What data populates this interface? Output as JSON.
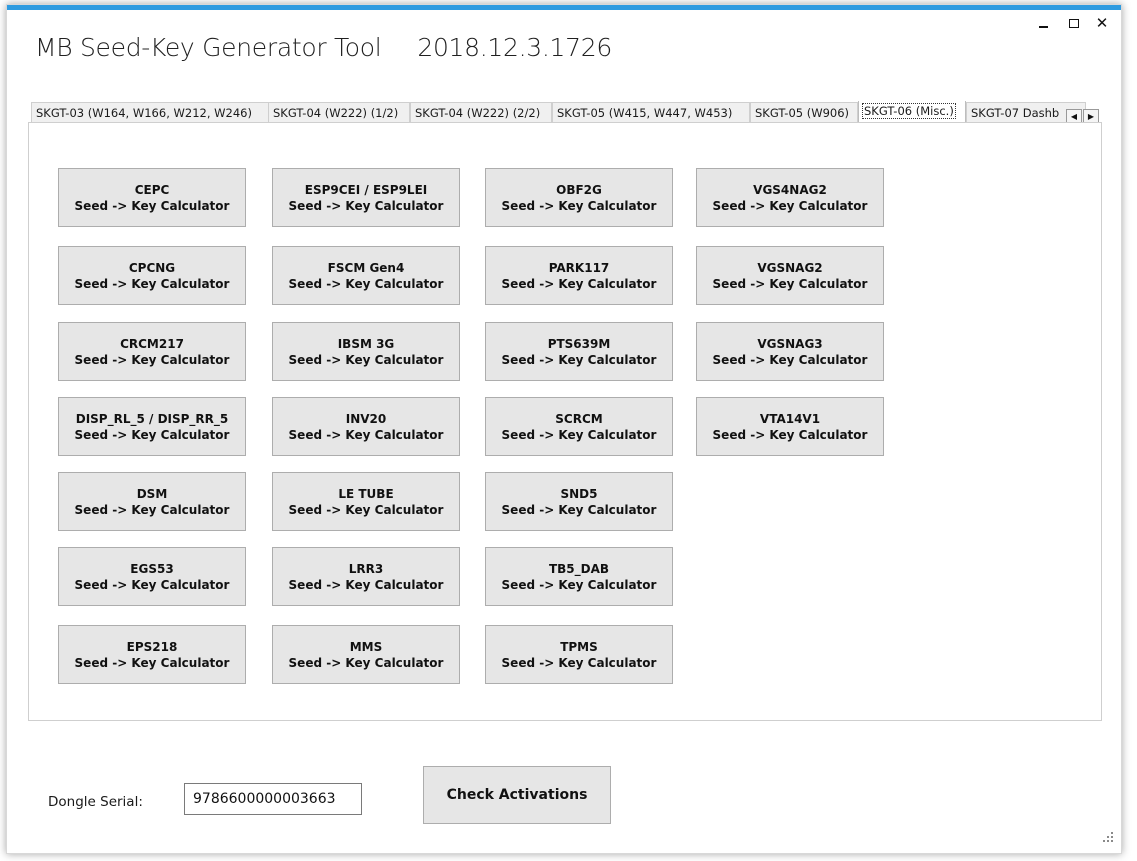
{
  "window": {
    "title": "MB Seed-Key Generator Tool",
    "version": "2018.12.3.1726",
    "minimize_label": "",
    "maximize_label": "",
    "close_label": "✕"
  },
  "tabs": [
    {
      "label": "SKGT-03 (W164, W166, W212, W246)",
      "active": false
    },
    {
      "label": "SKGT-04 (W222) (1/2)",
      "active": false
    },
    {
      "label": "SKGT-04 (W222) (2/2)",
      "active": false
    },
    {
      "label": "SKGT-05 (W415, W447, W453)",
      "active": false
    },
    {
      "label": "SKGT-05 (W906)",
      "active": false
    },
    {
      "label": "SKGT-06 (Misc.)",
      "active": true
    },
    {
      "label": "SKGT-07 Dashb",
      "active": false
    }
  ],
  "tab_scroll": {
    "left": "◀",
    "right": "▶"
  },
  "calculators": {
    "col1": [
      {
        "name": "CEPC",
        "caption": "Seed -> Key Calculator"
      },
      {
        "name": "CPCNG",
        "caption": "Seed -> Key Calculator"
      },
      {
        "name": "CRCM217",
        "caption": "Seed -> Key Calculator"
      },
      {
        "name": "DISP_RL_5 / DISP_RR_5",
        "caption": "Seed -> Key Calculator"
      },
      {
        "name": "DSM",
        "caption": "Seed -> Key Calculator"
      },
      {
        "name": "EGS53",
        "caption": "Seed -> Key Calculator"
      },
      {
        "name": "EPS218",
        "caption": "Seed -> Key Calculator"
      }
    ],
    "col2": [
      {
        "name": "ESP9CEI / ESP9LEI",
        "caption": "Seed -> Key Calculator"
      },
      {
        "name": "FSCM Gen4",
        "caption": "Seed -> Key Calculator"
      },
      {
        "name": "IBSM 3G",
        "caption": "Seed -> Key Calculator"
      },
      {
        "name": "INV20",
        "caption": "Seed -> Key Calculator"
      },
      {
        "name": "LE TUBE",
        "caption": "Seed -> Key Calculator"
      },
      {
        "name": "LRR3",
        "caption": "Seed -> Key Calculator"
      },
      {
        "name": "MMS",
        "caption": "Seed -> Key Calculator"
      }
    ],
    "col3": [
      {
        "name": "OBF2G",
        "caption": "Seed -> Key Calculator"
      },
      {
        "name": "PARK117",
        "caption": "Seed -> Key Calculator"
      },
      {
        "name": "PTS639M",
        "caption": "Seed -> Key Calculator"
      },
      {
        "name": "SCRCM",
        "caption": "Seed -> Key Calculator"
      },
      {
        "name": "SND5",
        "caption": "Seed -> Key Calculator"
      },
      {
        "name": "TB5_DAB",
        "caption": "Seed -> Key Calculator"
      },
      {
        "name": "TPMS",
        "caption": "Seed -> Key Calculator"
      }
    ],
    "col4": [
      {
        "name": "VGS4NAG2",
        "caption": "Seed -> Key Calculator"
      },
      {
        "name": "VGSNAG2",
        "caption": "Seed -> Key Calculator"
      },
      {
        "name": "VGSNAG3",
        "caption": "Seed -> Key Calculator"
      },
      {
        "name": "VTA14V1",
        "caption": "Seed -> Key Calculator"
      }
    ]
  },
  "footer": {
    "dongle_label": "Dongle Serial:",
    "dongle_value": "9786600000003663",
    "check_label": "Check Activations"
  }
}
